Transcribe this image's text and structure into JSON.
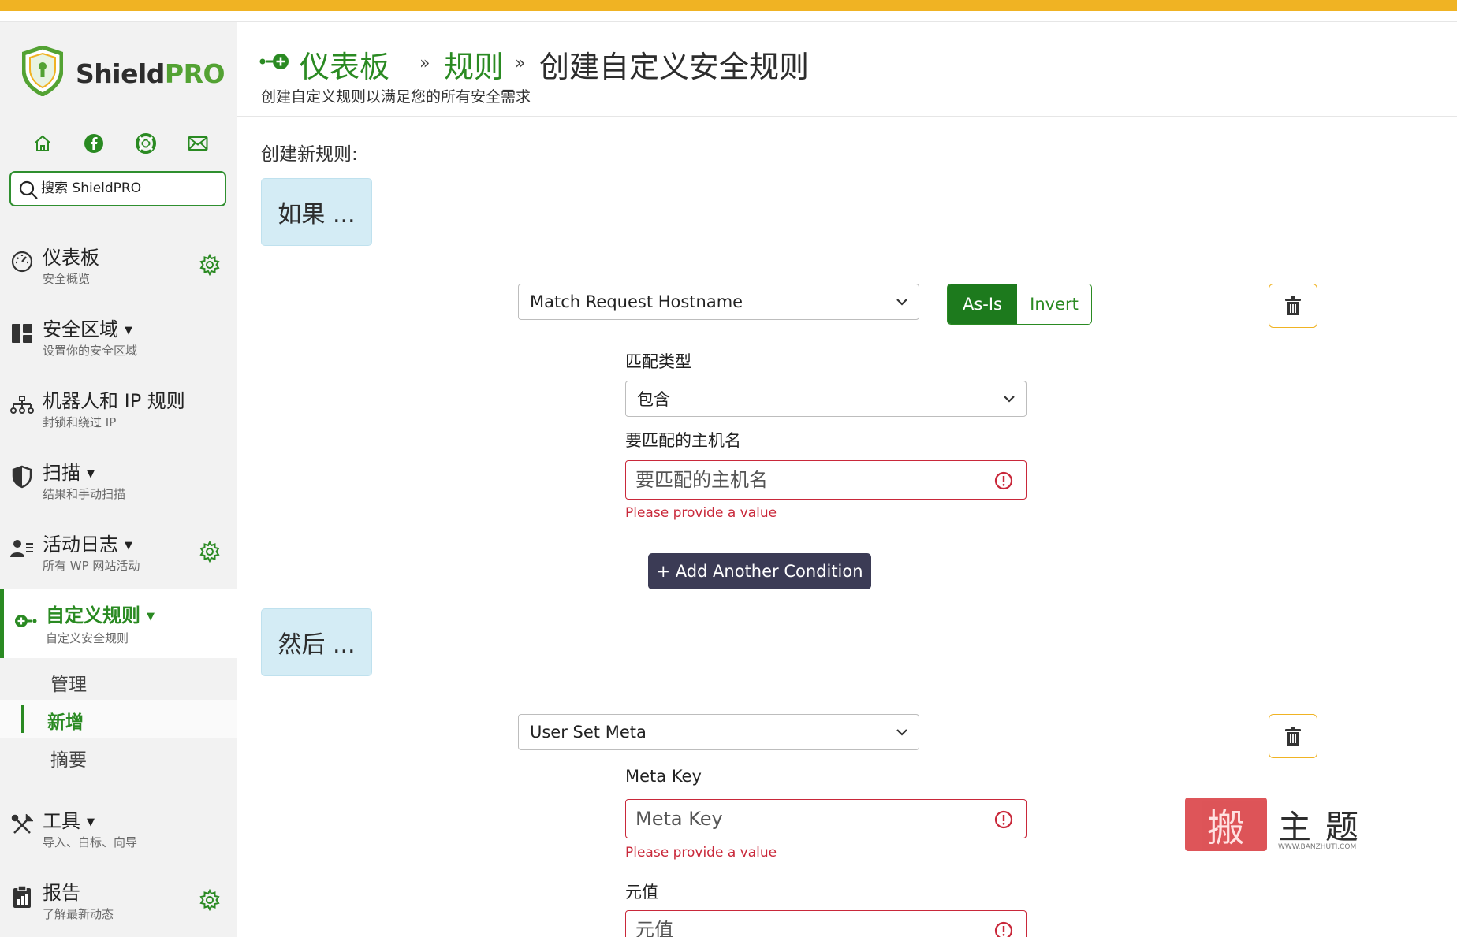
{
  "brand": {
    "shield": "Shield",
    "pro": "PRO"
  },
  "colors": {
    "accent": "#2a8a22",
    "topbar": "#f0b323",
    "error": "#c9283a",
    "section_bg": "#d4ecf5",
    "button_dark": "#3b3b55"
  },
  "quick_links": [
    {
      "icon": "home-icon"
    },
    {
      "icon": "facebook-icon"
    },
    {
      "icon": "lifebuoy-icon"
    },
    {
      "icon": "mail-icon"
    }
  ],
  "search": {
    "placeholder": "搜索 ShieldPRO"
  },
  "nav": {
    "dashboard": {
      "title": "仪表板",
      "sub": "安全概览"
    },
    "zones": {
      "title": "安全区域",
      "sub": "设置你的安全区域"
    },
    "bots": {
      "title": "机器人和 IP 规则",
      "sub": "封锁和绕过 IP"
    },
    "scans": {
      "title": "扫描",
      "sub": "结果和手动扫描"
    },
    "activity": {
      "title": "活动日志",
      "sub": "所有 WP 网站活动"
    },
    "rules": {
      "title": "自定义规则",
      "sub": "自定义安全规则"
    },
    "rules_sub": [
      "管理",
      "新增",
      "摘要"
    ],
    "tools": {
      "title": "工具",
      "sub": "导入、白标、向导"
    },
    "reports": {
      "title": "报告",
      "sub": "了解最新动态"
    }
  },
  "header": {
    "crumb1": "仪表板",
    "crumb2": "规则",
    "crumb3": "创建自定义安全规则",
    "sep": "»",
    "desc": "创建自定义规则以满足您的所有安全需求"
  },
  "form": {
    "new_rule_label": "创建新规则:",
    "if_label": "如果 ...",
    "then_label": "然后 ...",
    "condition_select": "Match Request Hostname",
    "as_is": "As-Is",
    "invert": "Invert",
    "match_type_label": "匹配类型",
    "match_type_value": "包含",
    "hostname_label": "要匹配的主机名",
    "hostname_placeholder": "要匹配的主机名",
    "error_msg": "Please provide a value",
    "add_condition": "+ Add Another Condition",
    "action_select": "User Set Meta",
    "meta_key_label": "Meta Key",
    "meta_key_placeholder": "Meta Key",
    "meta_value_label": "元值",
    "meta_value_placeholder": "元值"
  },
  "watermark": {
    "a": "搬",
    "b": "主题",
    "url": "WWW.BANZHUTI.COM"
  }
}
